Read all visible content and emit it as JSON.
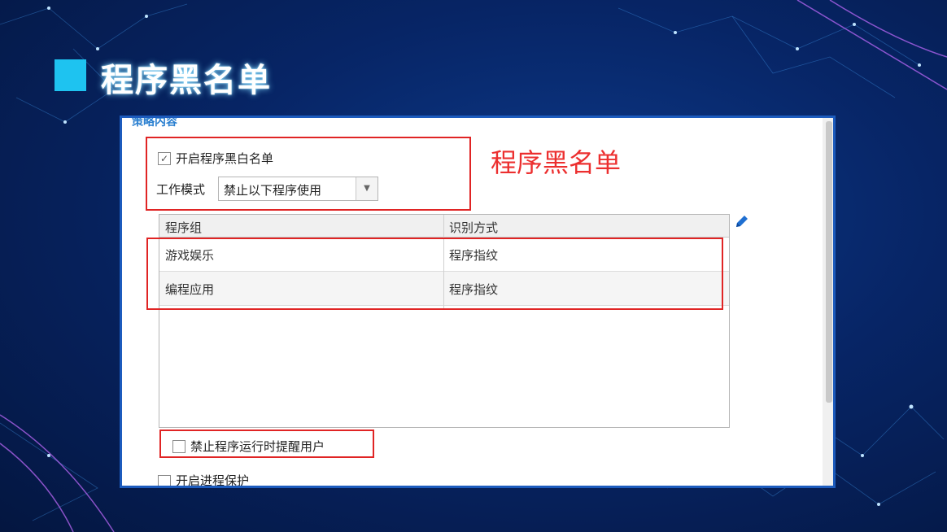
{
  "slide": {
    "title": "程序黑名单",
    "annotation": "程序黑名单",
    "accent_color": "#1ec3f0",
    "annotation_color": "#ec2f2f"
  },
  "policy_panel": {
    "section_label": "策略内容",
    "enable_list": {
      "label": "开启程序黑白名单",
      "checked": true
    },
    "work_mode": {
      "label": "工作模式",
      "value": "禁止以下程序使用"
    },
    "table": {
      "columns": [
        "程序组",
        "识别方式"
      ],
      "rows": [
        [
          "游戏娱乐",
          "程序指纹"
        ],
        [
          "编程应用",
          "程序指纹"
        ]
      ]
    },
    "notify_user": {
      "label": "禁止程序运行时提醒用户",
      "checked": false
    },
    "process_protect": {
      "label": "开启进程保护",
      "checked": false
    }
  },
  "icons": {
    "edit": "pencil-icon",
    "dropdown": "chevron-down-icon"
  }
}
